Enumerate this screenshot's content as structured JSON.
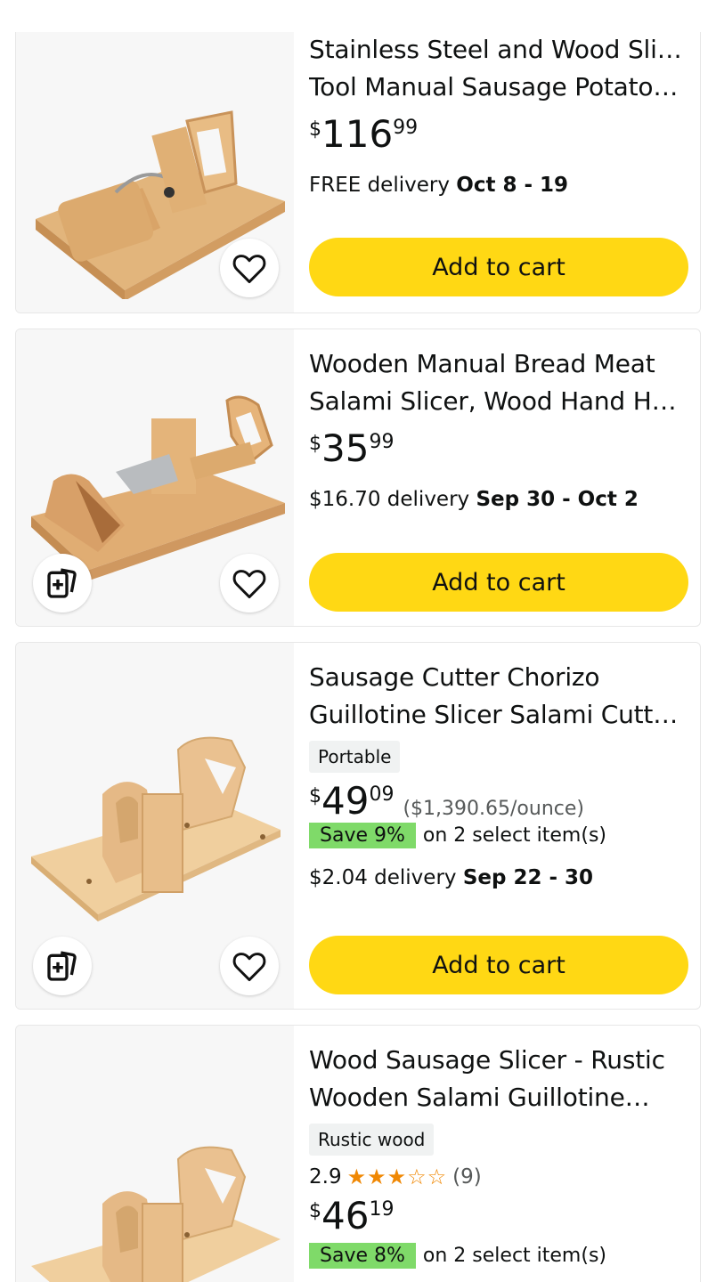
{
  "colors": {
    "button_yellow": "#ffd814",
    "save_green": "#7fda69",
    "star_orange": "#f08804",
    "badge_gray": "#f0f2f2"
  },
  "products": [
    {
      "title_line1": "Stainless Steel and Wood Slicer",
      "title_line2": "Tool Manual Sausage Potato…",
      "price_symbol": "$",
      "price_whole": "116",
      "price_fraction": "99",
      "delivery_prefix": "FREE delivery ",
      "delivery_dates": "Oct 8 - 19",
      "cart_label": "Add to cart",
      "icons": [
        "heart-icon"
      ]
    },
    {
      "title_line1": "Wooden Manual Bread Meat",
      "title_line2": "Salami Slicer, Wood Hand Hel…",
      "price_symbol": "$",
      "price_whole": "35",
      "price_fraction": "99",
      "delivery_prefix": "$16.70 delivery ",
      "delivery_dates": "Sep 30 - Oct 2",
      "cart_label": "Add to cart",
      "icons": [
        "compare-icon",
        "heart-icon"
      ]
    },
    {
      "title_line1": "Sausage Cutter Chorizo",
      "title_line2": "Guillotine Slicer Salami Cutte…",
      "badge": "Portable",
      "price_symbol": "$",
      "price_whole": "49",
      "price_fraction": "09",
      "unit_price": "($1,390.65/ounce)",
      "save_badge": "Save 9%",
      "save_text": "on 2 select item(s)",
      "delivery_prefix": "$2.04 delivery ",
      "delivery_dates": "Sep 22 - 30",
      "cart_label": "Add to cart",
      "icons": [
        "compare-icon",
        "heart-icon"
      ]
    },
    {
      "title_line1": "Wood Sausage Slicer - Rustic",
      "title_line2": "Wooden Salami Guillotine…",
      "badge": "Rustic wood",
      "rating_value": "2.9",
      "rating_stars": 2.9,
      "rating_stars_text": "★★★☆☆",
      "rating_count": "(9)",
      "price_symbol": "$",
      "price_whole": "46",
      "price_fraction": "19",
      "save_badge": "Save 8%",
      "save_text": "on 2 select item(s)"
    }
  ]
}
